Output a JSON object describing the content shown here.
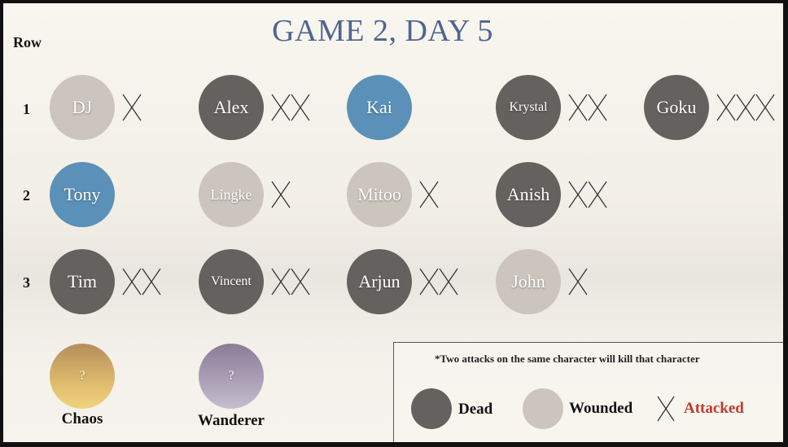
{
  "title": "GAME 2, DAY 5",
  "row_header": "Row",
  "rows": [
    {
      "label": "1",
      "characters": [
        {
          "name": "DJ",
          "status": "wounded",
          "attacks": 1
        },
        {
          "name": "Alex",
          "status": "dead",
          "attacks": 2
        },
        {
          "name": "Kai",
          "status": "alive",
          "attacks": 0
        },
        {
          "name": "Krystal",
          "status": "dead",
          "attacks": 2
        },
        {
          "name": "Goku",
          "status": "dead",
          "attacks": 3
        }
      ]
    },
    {
      "label": "2",
      "characters": [
        {
          "name": "Tony",
          "status": "alive",
          "attacks": 0
        },
        {
          "name": "Lingke",
          "status": "wounded",
          "attacks": 1
        },
        {
          "name": "Mitoo",
          "status": "wounded",
          "attacks": 1
        },
        {
          "name": "Anish",
          "status": "dead",
          "attacks": 2
        }
      ]
    },
    {
      "label": "3",
      "characters": [
        {
          "name": "Tim",
          "status": "dead",
          "attacks": 2
        },
        {
          "name": "Vincent",
          "status": "dead",
          "attacks": 2
        },
        {
          "name": "Arjun",
          "status": "dead",
          "attacks": 2
        },
        {
          "name": "John",
          "status": "wounded",
          "attacks": 1
        }
      ]
    }
  ],
  "specials": [
    {
      "name": "Chaos",
      "symbol": "?",
      "style": "chaos"
    },
    {
      "name": "Wanderer",
      "symbol": "?",
      "style": "wanderer"
    }
  ],
  "legend": {
    "note": "*Two attacks on the same character will kill that character",
    "dead_label": "Dead",
    "wounded_label": "Wounded",
    "attacked_label": "Attacked"
  },
  "colors": {
    "dead": "#65615e",
    "wounded": "#cbc5bd",
    "alive": "#5b90b8",
    "title": "#4f6590",
    "attacked_text": "#c0392b"
  }
}
